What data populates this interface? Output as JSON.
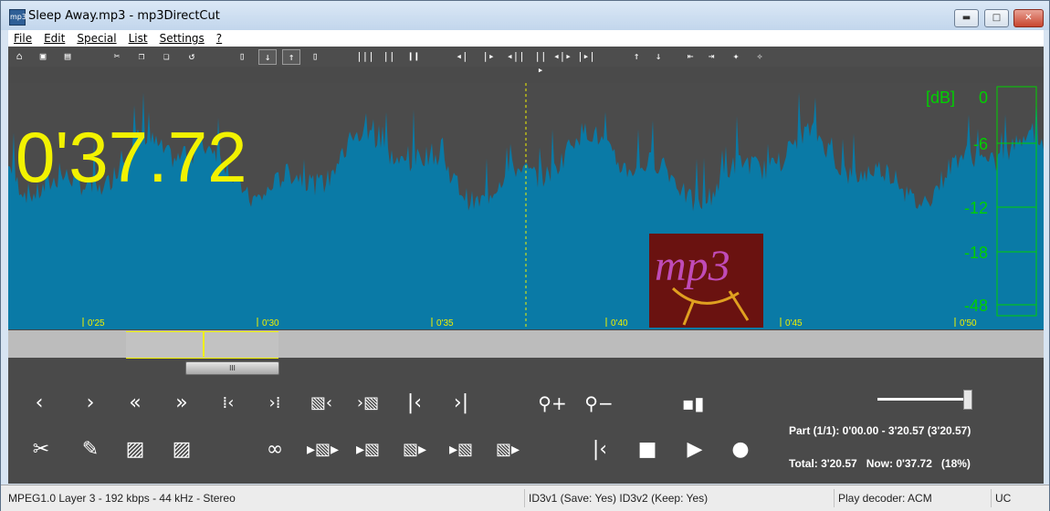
{
  "window": {
    "title": "Sleep Away.mp3 - mp3DirectCut",
    "app_icon": "mp3",
    "controls": {
      "minimize": "▬",
      "maximize": "□",
      "close": "✕"
    }
  },
  "menu": [
    "File",
    "Edit",
    "Special",
    "List",
    "Settings",
    "?"
  ],
  "waveform": {
    "time_display": "0'37.72",
    "db_label": "[dB]",
    "db_scale": [
      "0",
      "-6",
      "-12",
      "-18",
      "-48"
    ],
    "time_ticks": [
      "0'25",
      "0'30",
      "0'35",
      "0'40",
      "0'45",
      "0'50"
    ],
    "logo_text": "mp3",
    "colors": {
      "wave": "#0a7aa6",
      "background": "#4b4b4b",
      "time_display": "#f2f200",
      "meter": "#00d000",
      "cursor": "#f0f000"
    }
  },
  "timeline": {
    "thumb_label": "III"
  },
  "controls_row1": [
    "prev",
    "next",
    "rewind",
    "fast-forward",
    "start-of-selection",
    "end-of-selection",
    "select-to-start",
    "select-to-end",
    "go-to-start",
    "go-to-end",
    "zoom-in",
    "zoom-out",
    "pause-marker"
  ],
  "controls_row2": [
    "cut",
    "edit-pencil",
    "fade-in",
    "fade-out",
    "loop",
    "play-selection",
    "play-from",
    "play-region",
    "play-to-end",
    "play-end",
    "skip-to-start",
    "stop",
    "play",
    "record"
  ],
  "info": {
    "part": "Part (1/1): 0'00.00 - 3'20.57 (3'20.57)",
    "total": "Total: 3'20.57",
    "now": "Now: 0'37.72",
    "percent": "(18%)",
    "volume": 0.98
  },
  "status": {
    "format": "MPEG1.0 Layer 3 - 192 kbps - 44 kHz - Stereo",
    "id3": "ID3v1 (Save: Yes)   ID3v2 (Keep: Yes)",
    "decoder": "Play decoder: ACM",
    "mode": "UC"
  }
}
